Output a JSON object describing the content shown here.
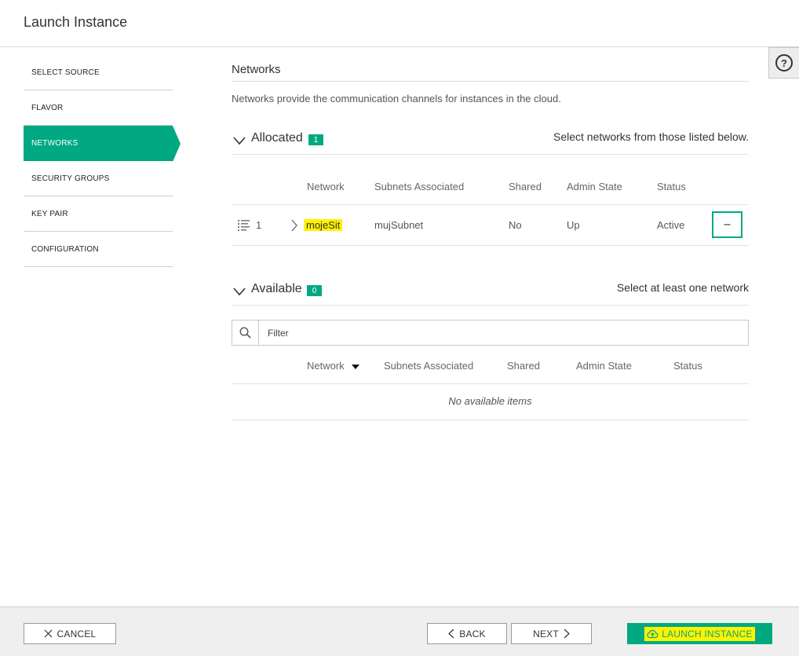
{
  "header": {
    "title": "Launch Instance"
  },
  "help": {
    "glyph": "?"
  },
  "sidebar": {
    "items": [
      {
        "label": "SELECT SOURCE"
      },
      {
        "label": "FLAVOR"
      },
      {
        "label": "NETWORKS"
      },
      {
        "label": "SECURITY GROUPS"
      },
      {
        "label": "KEY PAIR"
      },
      {
        "label": "CONFIGURATION"
      }
    ],
    "active_index": 2
  },
  "main": {
    "title": "Networks",
    "description": "Networks provide the communication channels for instances in the cloud.",
    "allocated": {
      "label": "Allocated",
      "count": "1",
      "hint": "Select networks from those listed below.",
      "columns": [
        "Network",
        "Subnets Associated",
        "Shared",
        "Admin State",
        "Status"
      ],
      "rows": [
        {
          "order": "1",
          "network": "mojeSit",
          "subnets": "mujSubnet",
          "shared": "No",
          "admin_state": "Up",
          "status": "Active",
          "remove_glyph": "−"
        }
      ]
    },
    "available": {
      "label": "Available",
      "count": "0",
      "hint": "Select at least one network",
      "filter_placeholder": "Filter",
      "columns": [
        "Network",
        "Subnets Associated",
        "Shared",
        "Admin State",
        "Status"
      ],
      "empty_text": "No available items"
    }
  },
  "footer": {
    "cancel_label": "CANCEL",
    "back_label": "BACK",
    "next_label": "NEXT",
    "launch_label": "LAUNCH INSTANCE"
  },
  "colors": {
    "accent": "#01a982",
    "highlight": "#fff200"
  }
}
